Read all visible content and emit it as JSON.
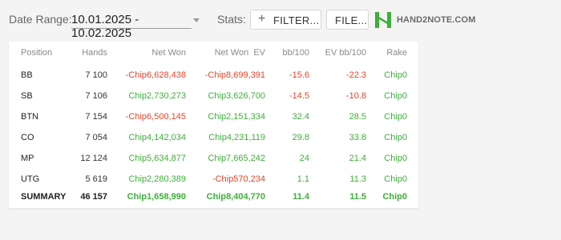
{
  "toolbar": {
    "date_range_label": "Date Range:",
    "date_range_value": "10.01.2025 - 10.02.2025",
    "stats_label": "Stats:",
    "filter_button": "FILTER...",
    "file_button": "FILE...",
    "logo_text": "HAND2NOTE.COM"
  },
  "colors": {
    "positive": "#3fae3b",
    "negative": "#e0452c",
    "logo_green": "#3fae3b"
  },
  "table": {
    "headers": [
      "Position",
      "Hands",
      "Net Won",
      "Net Won  EV",
      "bb/100",
      "EV bb/100",
      "Rake"
    ],
    "rows": [
      {
        "position": "BB",
        "hands": "7 100",
        "net_won": "-Chip6,628,438",
        "net_won_ev": "-Chip8,699,391",
        "bb100": "-15.6",
        "ev_bb100": "-22.3",
        "rake": "Chip0"
      },
      {
        "position": "SB",
        "hands": "7 106",
        "net_won": "Chip2,730,273",
        "net_won_ev": "Chip3,626,700",
        "bb100": "-14.5",
        "ev_bb100": "-10.8",
        "rake": "Chip0"
      },
      {
        "position": "BTN",
        "hands": "7 154",
        "net_won": "-Chip6,500,145",
        "net_won_ev": "Chip2,151,334",
        "bb100": "32.4",
        "ev_bb100": "28.5",
        "rake": "Chip0"
      },
      {
        "position": "CO",
        "hands": "7 054",
        "net_won": "Chip4,142,034",
        "net_won_ev": "Chip4,231,119",
        "bb100": "29.8",
        "ev_bb100": "33.8",
        "rake": "Chip0"
      },
      {
        "position": "MP",
        "hands": "12 124",
        "net_won": "Chip5,634,877",
        "net_won_ev": "Chip7,665,242",
        "bb100": "24",
        "ev_bb100": "21.4",
        "rake": "Chip0"
      },
      {
        "position": "UTG",
        "hands": "5 619",
        "net_won": "Chip2,280,389",
        "net_won_ev": "-Chip570,234",
        "bb100": "1.1",
        "ev_bb100": "11.3",
        "rake": "Chip0"
      }
    ],
    "summary": {
      "position": "SUMMARY",
      "hands": "46 157",
      "net_won": "Chip1,658,990",
      "net_won_ev": "Chip8,404,770",
      "bb100": "11.4",
      "ev_bb100": "11.5",
      "rake": "Chip0"
    }
  }
}
